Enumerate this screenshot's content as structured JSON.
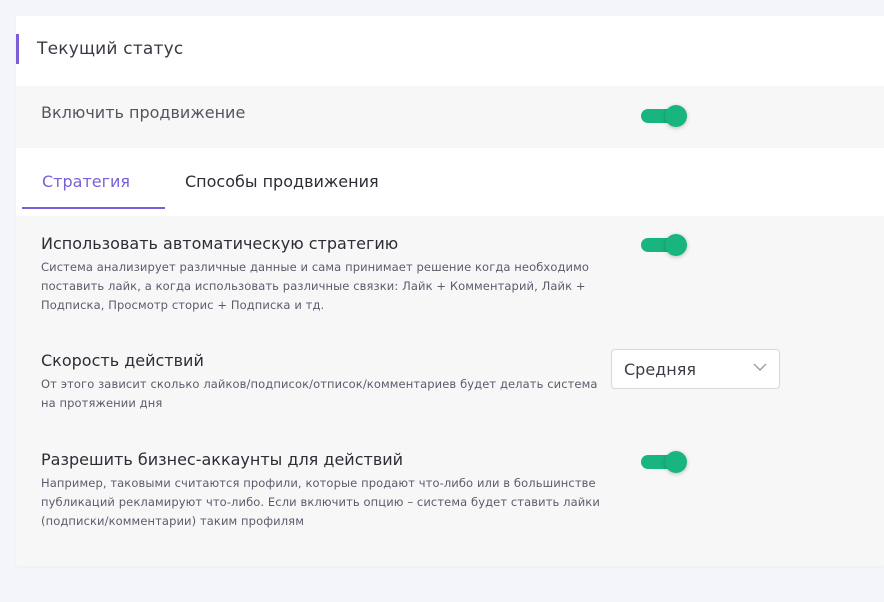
{
  "status": {
    "title": "Текущий статус"
  },
  "promotion": {
    "label": "Включить продвижение",
    "enabled": true
  },
  "tabs": [
    {
      "label": "Стратегия",
      "active": true
    },
    {
      "label": "Способы продвижения",
      "active": false
    }
  ],
  "settings": {
    "auto_strategy": {
      "title": "Использовать автоматическую стратегию",
      "description": "Система анализирует различные данные и сама принимает решение когда необходимо поставить лайк, а когда использовать различные связки: Лайк + Комментарий, Лайк + Подписка, Просмотр сторис + Подписка и тд.",
      "enabled": true
    },
    "speed": {
      "title": "Скорость действий",
      "description": "От этого зависит сколько лайков/подписок/отписок/комментариев будет делать система на протяжении дня",
      "selected": "Средняя"
    },
    "business_accounts": {
      "title": "Разрешить бизнес-аккаунты для действий",
      "description": "Например, таковыми считаются профили, которые продают что-либо или в большинстве публикаций рекламируют что-либо. Если включить опцию – система будет ставить лайки (подписки/комментарии) таким профилям",
      "enabled": true
    }
  },
  "colors": {
    "accent": "#7b5fd6",
    "toggle_on": "#18b57f",
    "row_background": "#f7f7f8",
    "page_background": "#f3f5f9"
  }
}
